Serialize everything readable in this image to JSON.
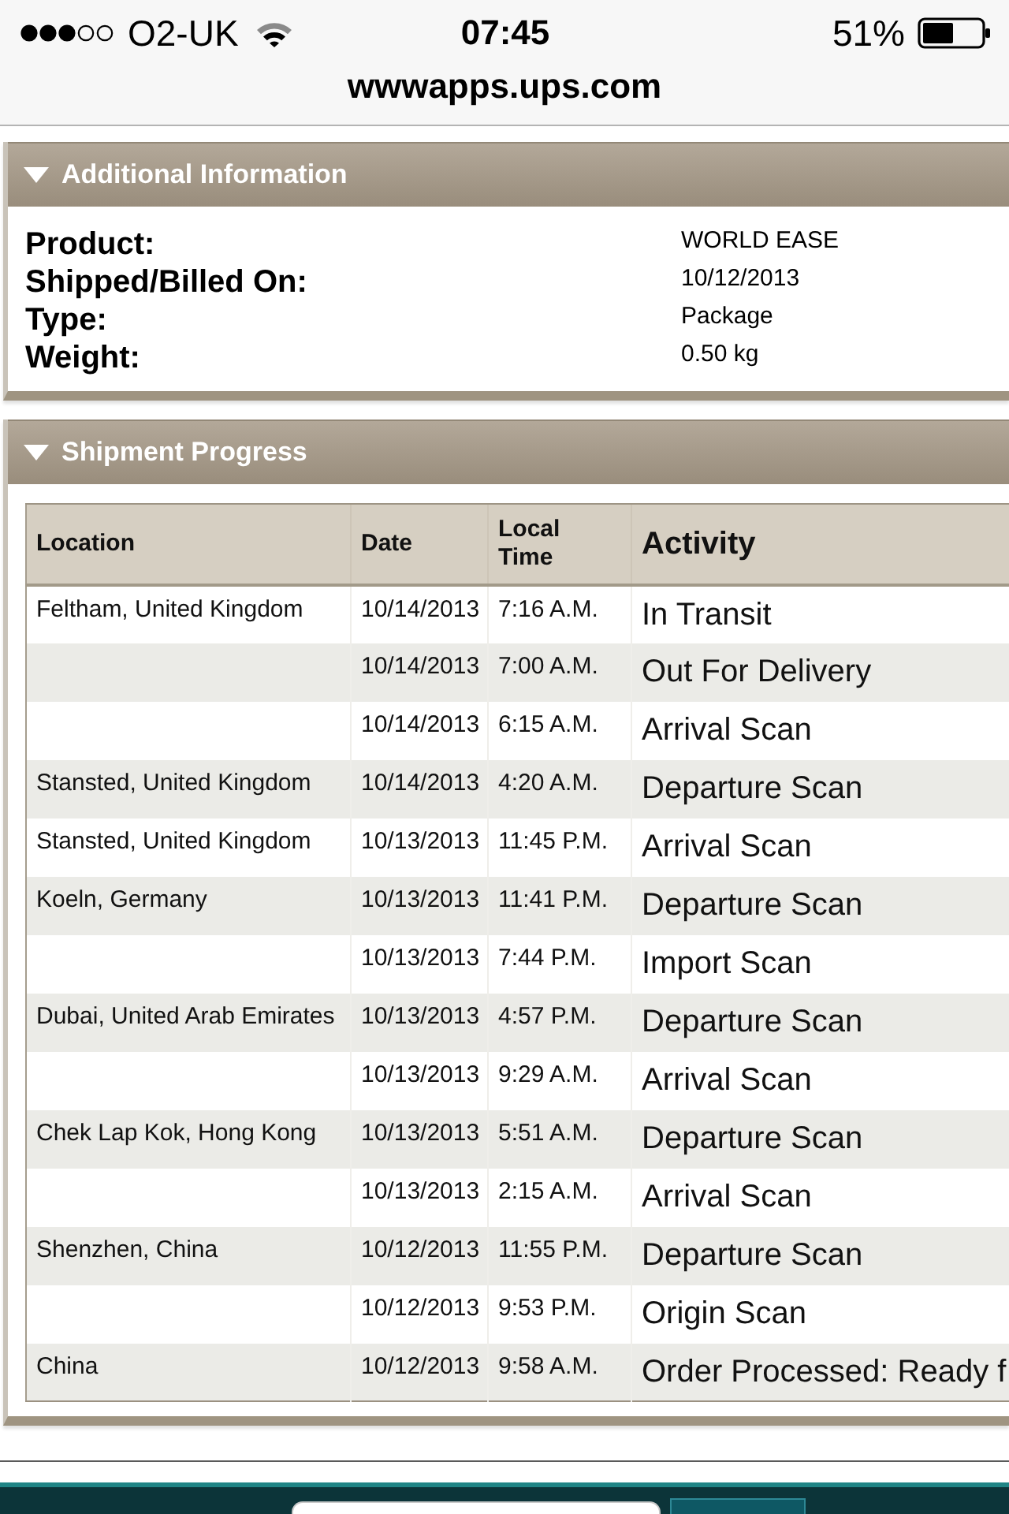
{
  "status_bar": {
    "carrier": "O2-UK",
    "time": "07:45",
    "battery": "51%"
  },
  "address_bar": {
    "url": "wwwapps.ups.com"
  },
  "additional_information": {
    "title": "Additional Information",
    "expanded": true,
    "fields": [
      {
        "label": "Product:",
        "value": "WORLD EASE"
      },
      {
        "label": "Shipped/Billed On:",
        "value": "10/12/2013"
      },
      {
        "label": "Type:",
        "value": "Package"
      },
      {
        "label": "Weight:",
        "value": "0.50 kg"
      }
    ]
  },
  "shipment_progress": {
    "title": "Shipment Progress",
    "expanded": true,
    "table": {
      "columns": [
        "Location",
        "Date",
        "Local Time",
        "Activity"
      ],
      "rows": [
        {
          "location": "Feltham, United Kingdom",
          "date": "10/14/2013",
          "time": "7:16 A.M.",
          "activity": "In Transit"
        },
        {
          "date": "10/14/2013",
          "time": "7:00 A.M.",
          "activity": "Out For Delivery"
        },
        {
          "date": "10/14/2013",
          "time": "6:15 A.M.",
          "activity": "Arrival Scan"
        },
        {
          "location": "Stansted, United Kingdom",
          "date": "10/14/2013",
          "time": "4:20 A.M.",
          "activity": "Departure Scan"
        },
        {
          "location": "Stansted, United Kingdom",
          "date": "10/13/2013",
          "time": "11:45 P.M.",
          "activity": "Arrival Scan"
        },
        {
          "location": "Koeln, Germany",
          "date": "10/13/2013",
          "time": "11:41 P.M.",
          "activity": "Departure Scan"
        },
        {
          "date": "10/13/2013",
          "time": "7:44 P.M.",
          "activity": "Import Scan"
        },
        {
          "location": "Dubai, United Arab Emirates",
          "date": "10/13/2013",
          "time": "4:57 P.M.",
          "activity": "Departure Scan"
        },
        {
          "date": "10/13/2013",
          "time": "9:29 A.M.",
          "activity": "Arrival Scan"
        },
        {
          "location": "Chek Lap Kok, Hong Kong",
          "date": "10/13/2013",
          "time": "5:51 A.M.",
          "activity": "Departure Scan"
        },
        {
          "date": "10/13/2013",
          "time": "2:15 A.M.",
          "activity": "Arrival Scan"
        },
        {
          "location": "Shenzhen, China",
          "date": "10/12/2013",
          "time": "11:55 P.M.",
          "activity": "Departure Scan"
        },
        {
          "date": "10/12/2013",
          "time": "9:53 P.M.",
          "activity": "Origin Scan"
        },
        {
          "location": "China",
          "date": "10/12/2013",
          "time": "9:58 A.M.",
          "activity": "Order Processed: Ready f"
        }
      ]
    }
  }
}
